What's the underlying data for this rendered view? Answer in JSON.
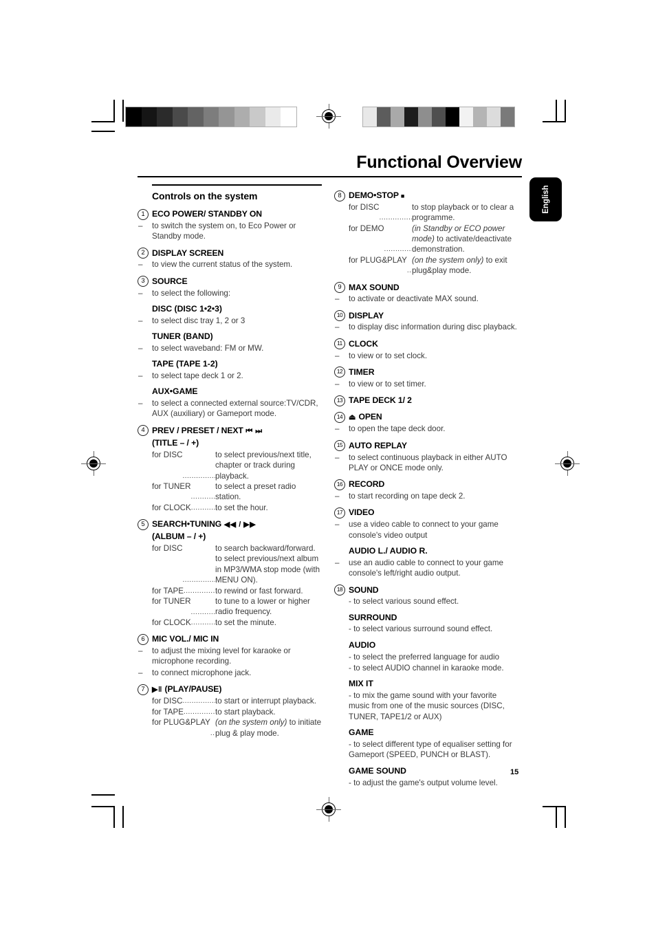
{
  "header": {
    "title": "Functional Overview",
    "language_tab": "English",
    "page_number": "15"
  },
  "left_column": {
    "section_heading": "Controls on the system",
    "entries": [
      {
        "num": "1",
        "heading": "ECO POWER/ STANDBY ON",
        "lines": [
          {
            "type": "dash",
            "text": "to switch the system on, to Eco Power or Standby mode."
          }
        ]
      },
      {
        "num": "2",
        "heading": "DISPLAY SCREEN",
        "lines": [
          {
            "type": "dash",
            "text": "to view the current status of the system."
          }
        ]
      },
      {
        "num": "3",
        "heading": "SOURCE",
        "lines": [
          {
            "type": "dash",
            "text": "to select the following:"
          },
          {
            "type": "sub",
            "text": "DISC (DISC 1•2•3)"
          },
          {
            "type": "dash",
            "text": "to select disc tray 1, 2 or 3"
          },
          {
            "type": "sub",
            "text": "TUNER (BAND)"
          },
          {
            "type": "dash",
            "text": "to select waveband: FM or MW."
          },
          {
            "type": "sub",
            "text": "TAPE (TAPE 1-2)"
          },
          {
            "type": "dash",
            "text": "to select tape deck 1 or 2."
          },
          {
            "type": "sub",
            "text": "AUX•GAME"
          },
          {
            "type": "dash",
            "text": "to select a connected external source:TV/CDR, AUX (auxiliary) or Gameport mode."
          }
        ]
      },
      {
        "num": "4",
        "heading": "PREV / PRESET / NEXT",
        "heading_symbol": "⏮ ⏭",
        "heading_line2": "(TITLE – / +)",
        "lines": [
          {
            "type": "lead",
            "label": "for DISC",
            "text": "to select previous/next title, chapter or track during playback."
          },
          {
            "type": "lead",
            "label": "for TUNER",
            "text": "to select a preset radio station."
          },
          {
            "type": "lead",
            "label": "for CLOCK",
            "text": "to set the hour."
          }
        ]
      },
      {
        "num": "5",
        "heading": "SEARCH•TUNING",
        "heading_symbol": "◀◀ / ▶▶",
        "heading_line2": "(ALBUM – / +)",
        "lines": [
          {
            "type": "lead",
            "label": "for DISC",
            "text": "to search backward/forward. to select previous/next album in MP3/WMA stop mode (with MENU ON)."
          },
          {
            "type": "lead",
            "label": "for TAPE",
            "text": "to rewind or fast forward."
          },
          {
            "type": "lead",
            "label": "for TUNER",
            "text": "to tune to a lower or higher radio frequency."
          },
          {
            "type": "lead",
            "label": "for CLOCK",
            "text": "to set the minute."
          }
        ]
      },
      {
        "num": "6",
        "heading": "MIC VOL./ MIC IN",
        "lines": [
          {
            "type": "dash",
            "text": "to adjust the mixing level for karaoke or microphone recording."
          },
          {
            "type": "dash",
            "text": "to connect microphone jack."
          }
        ]
      },
      {
        "num": "7",
        "heading": "(PLAY/PAUSE)",
        "heading_symbol": "▶‖",
        "symbol_first": true,
        "lines": [
          {
            "type": "lead",
            "label": "for DISC",
            "text": "to start or interrupt playback."
          },
          {
            "type": "lead",
            "label": "for TAPE",
            "text": "to start playback."
          },
          {
            "type": "lead",
            "label": "for PLUG&PLAY",
            "italic_prefix": "(on the system only)",
            "text": " to initiate plug & play mode."
          }
        ]
      }
    ]
  },
  "right_column": {
    "entries": [
      {
        "num": "8",
        "heading": "DEMO•STOP",
        "heading_symbol": "■",
        "lines": [
          {
            "type": "lead",
            "label": "for DISC",
            "text": "to stop playback or to clear a programme."
          },
          {
            "type": "lead",
            "label": "for DEMO",
            "italic_prefix": "(in Standby or ECO power mode)",
            "text": " to activate/deactivate demonstration."
          },
          {
            "type": "lead",
            "label": "for PLUG&PLAY",
            "italic_prefix": "(on the system only)",
            "text": " to exit plug&play mode."
          }
        ]
      },
      {
        "num": "9",
        "heading": "MAX SOUND",
        "lines": [
          {
            "type": "dash",
            "text": "to activate or deactivate MAX sound."
          }
        ]
      },
      {
        "num": "10",
        "heading": "DISPLAY",
        "lines": [
          {
            "type": "dash",
            "text": "to display disc information during disc playback."
          }
        ]
      },
      {
        "num": "11",
        "heading": "CLOCK",
        "lines": [
          {
            "type": "dash",
            "text": "to view or to set clock."
          }
        ]
      },
      {
        "num": "12",
        "heading": "TIMER",
        "lines": [
          {
            "type": "dash",
            "text": "to view or to set timer."
          }
        ]
      },
      {
        "num": "13",
        "heading": "TAPE DECK 1/ 2",
        "lines": []
      },
      {
        "num": "14",
        "heading": "OPEN",
        "heading_symbol": "⏏",
        "symbol_first": true,
        "lines": [
          {
            "type": "dash",
            "text": "to open the tape deck door."
          }
        ]
      },
      {
        "num": "15",
        "heading": "AUTO REPLAY",
        "lines": [
          {
            "type": "dash",
            "text": "to select continuous playback in either AUTO PLAY or ONCE mode only."
          }
        ]
      },
      {
        "num": "16",
        "heading": "RECORD",
        "lines": [
          {
            "type": "dash",
            "text": "to start recording on tape deck 2."
          }
        ]
      },
      {
        "num": "17",
        "heading": "VIDEO",
        "lines": [
          {
            "type": "dash",
            "text": "use a video cable to connect to your game console's video output"
          },
          {
            "type": "sub",
            "text": "AUDIO L./ AUDIO R."
          },
          {
            "type": "dash",
            "text": "use an audio cable to connect to your game console's left/right audio output."
          }
        ]
      },
      {
        "num": "18",
        "heading": "SOUND",
        "lines": [
          {
            "type": "plain",
            "text": "- to select various sound effect."
          },
          {
            "type": "sub",
            "text": "SURROUND"
          },
          {
            "type": "plain",
            "text": "- to select various surround sound effect."
          },
          {
            "type": "sub",
            "text": "AUDIO"
          },
          {
            "type": "plain",
            "text": "- to select the preferred language for audio"
          },
          {
            "type": "plain",
            "text": "- to select AUDIO channel in karaoke mode."
          },
          {
            "type": "sub",
            "text": "MIX IT"
          },
          {
            "type": "plain",
            "text": "- to mix the game sound with your favorite music from one of the music sources (DISC, TUNER, TAPE1/2 or AUX)"
          },
          {
            "type": "sub",
            "text": "GAME"
          },
          {
            "type": "plain",
            "text": "- to select different type of equaliser setting for Gameport (SPEED, PUNCH or BLAST)."
          },
          {
            "type": "sub",
            "text": "GAME SOUND"
          },
          {
            "type": "plain",
            "text": "- to adjust the game's output volume level."
          }
        ]
      }
    ]
  },
  "calibration": {
    "left_bar": [
      "#000000",
      "#151515",
      "#2b2b2b",
      "#4a4a4a",
      "#636363",
      "#7d7d7d",
      "#959595",
      "#adadad",
      "#c9c9c9",
      "#eaeaea",
      "#ffffff"
    ],
    "right_bar": [
      "#e8e8e8",
      "#5c5c5c",
      "#a9a9a9",
      "#1c1c1c",
      "#8e8e8e",
      "#4f4f4f",
      "#000000",
      "#f2f2f2",
      "#b4b4b4",
      "#dcdcdc",
      "#7a7a7a"
    ]
  }
}
